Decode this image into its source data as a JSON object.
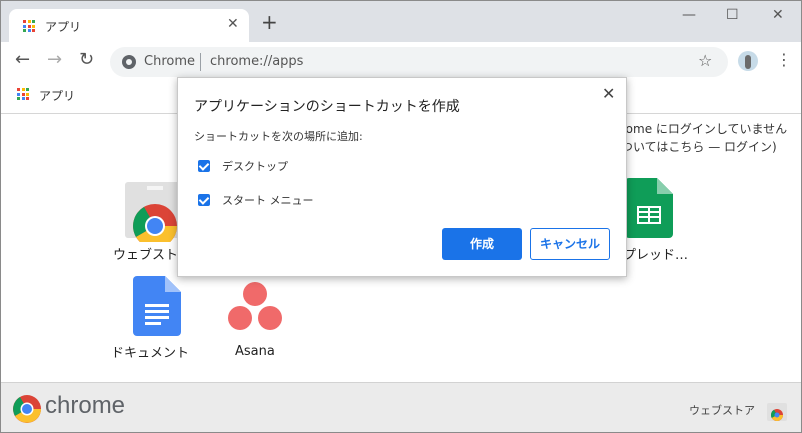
{
  "tab": {
    "title": "アプリ",
    "close": "✕",
    "new_tab": "+"
  },
  "window_controls": {
    "minimize": "—",
    "maximize": "☐",
    "close": "✕"
  },
  "toolbar": {
    "back": "←",
    "forward": "→",
    "reload": "↻",
    "star": "☆",
    "menu": "⋮"
  },
  "omnibox": {
    "chip": "Chrome",
    "url": "chrome://apps"
  },
  "bookmarks": {
    "apps_label": "アプリ"
  },
  "signin": {
    "line1": "rome にログインしていません",
    "line2": "ついてはこちら — ログイン)"
  },
  "apps": [
    {
      "label": "ウェブスト",
      "icon": "chrome-web-store-icon"
    },
    {
      "label": "プレッド…",
      "icon": "google-sheets-icon"
    },
    {
      "label": "ドキュメント",
      "icon": "google-docs-icon"
    },
    {
      "label": "Asana",
      "icon": "asana-icon"
    }
  ],
  "dialog": {
    "title": "アプリケーションのショートカットを作成",
    "subtitle": "ショートカットを次の場所に追加:",
    "option_desktop": "デスクトップ",
    "option_startmenu": "スタート メニュー",
    "desktop_checked": true,
    "startmenu_checked": true,
    "create_button": "作成",
    "cancel_button": "キャンセル",
    "close": "✕"
  },
  "footer": {
    "brand": "chrome",
    "store_link": "ウェブストア"
  },
  "colors": {
    "accent": "#1a73e8",
    "tabstrip": "#dee1e6",
    "footer": "#ebebeb"
  }
}
